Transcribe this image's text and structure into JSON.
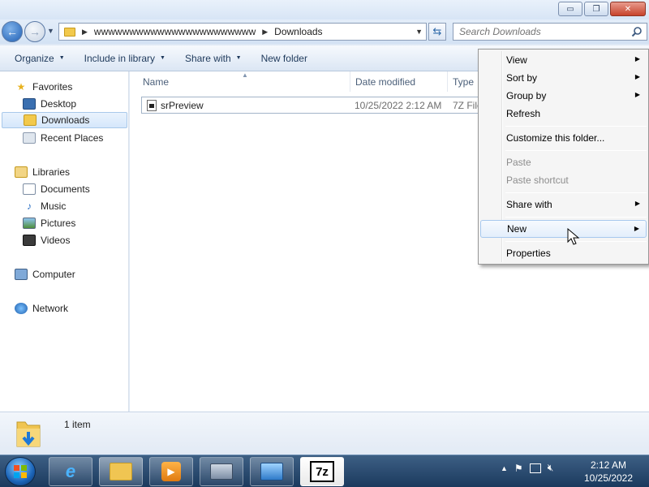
{
  "window": {
    "controls": {
      "minimize": "▭",
      "maximize": "❐",
      "close": "✕"
    }
  },
  "address": {
    "crumbs": [
      "wwwwwwwwwwwwwwwwwwwwwww",
      "Downloads"
    ],
    "search_placeholder": "Search Downloads"
  },
  "commandbar": {
    "items": [
      "Organize",
      "Include in library",
      "Share with",
      "New folder"
    ]
  },
  "sidebar": {
    "favorites": {
      "label": "Favorites",
      "items": [
        "Desktop",
        "Downloads",
        "Recent Places"
      ]
    },
    "libraries": {
      "label": "Libraries",
      "items": [
        "Documents",
        "Music",
        "Pictures",
        "Videos"
      ]
    },
    "computer": "Computer",
    "network": "Network"
  },
  "filelist": {
    "columns": [
      "Name",
      "Date modified",
      "Type"
    ],
    "rows": [
      {
        "name": "srPreview",
        "date": "10/25/2022 2:12 AM",
        "type": "7Z File"
      }
    ]
  },
  "details": {
    "count": "1 item"
  },
  "context_menu": {
    "items": [
      {
        "label": "View",
        "submenu": true,
        "disabled": false
      },
      {
        "label": "Sort by",
        "submenu": true,
        "disabled": false
      },
      {
        "label": "Group by",
        "submenu": true,
        "disabled": false
      },
      {
        "label": "Refresh",
        "submenu": false,
        "disabled": false
      },
      {
        "label": "Customize this folder...",
        "submenu": false,
        "disabled": false
      },
      {
        "label": "Paste",
        "submenu": false,
        "disabled": true
      },
      {
        "label": "Paste shortcut",
        "submenu": false,
        "disabled": true
      },
      {
        "label": "Share with",
        "submenu": true,
        "disabled": false
      },
      {
        "label": "New",
        "submenu": true,
        "disabled": false,
        "highlighted": true
      },
      {
        "label": "Properties",
        "submenu": false,
        "disabled": false
      }
    ]
  },
  "taskbar": {
    "app_7z_label": "7z",
    "clock_time": "2:12 AM",
    "clock_date": "10/25/2022"
  },
  "colors": {
    "accent": "#1f5fb4",
    "taskbar": "#1b3a5e",
    "selection": "#d5e7fb",
    "menu_highlight": "#e3eefb"
  }
}
